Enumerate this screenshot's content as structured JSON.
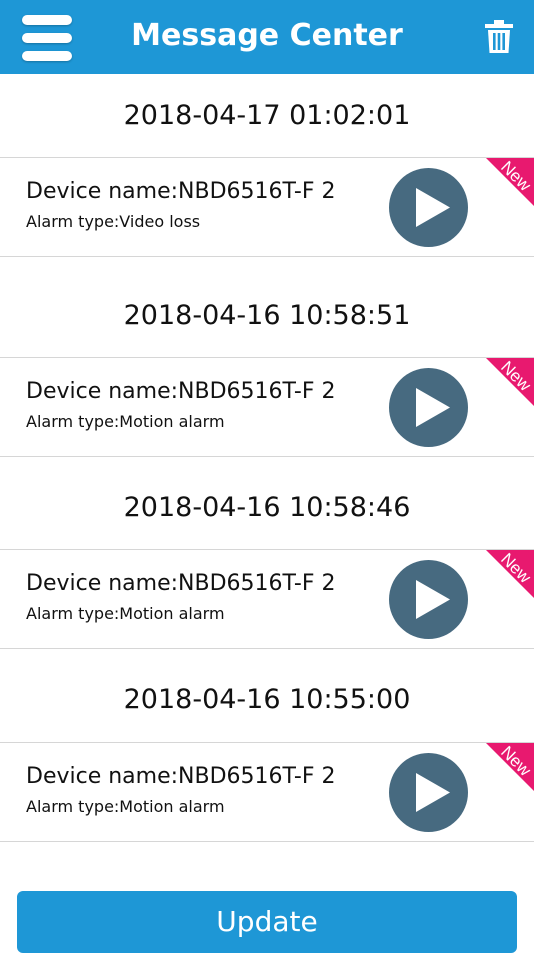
{
  "header": {
    "title": "Message Center",
    "menu_icon": "hamburger-menu-icon",
    "trash_icon": "trash-icon"
  },
  "messages": [
    {
      "datetime": "2018-04-17 01:02:01",
      "device_name": "Device name:NBD6516T-F 2",
      "alarm_type": "Alarm type:Video loss",
      "badge": "New"
    },
    {
      "datetime": "2018-04-16 10:58:51",
      "device_name": "Device name:NBD6516T-F 2",
      "alarm_type": "Alarm type:Motion alarm",
      "badge": "New"
    },
    {
      "datetime": "2018-04-16 10:58:46",
      "device_name": "Device name:NBD6516T-F 2",
      "alarm_type": "Alarm type:Motion alarm",
      "badge": "New"
    },
    {
      "datetime": "2018-04-16 10:55:00",
      "device_name": "Device name:NBD6516T-F 2",
      "alarm_type": "Alarm type:Motion alarm",
      "badge": "New"
    }
  ],
  "footer": {
    "update_label": "Update"
  },
  "colors": {
    "header_bg": "#1e97d6",
    "play_button": "#476a80",
    "new_badge": "#e8196f"
  }
}
